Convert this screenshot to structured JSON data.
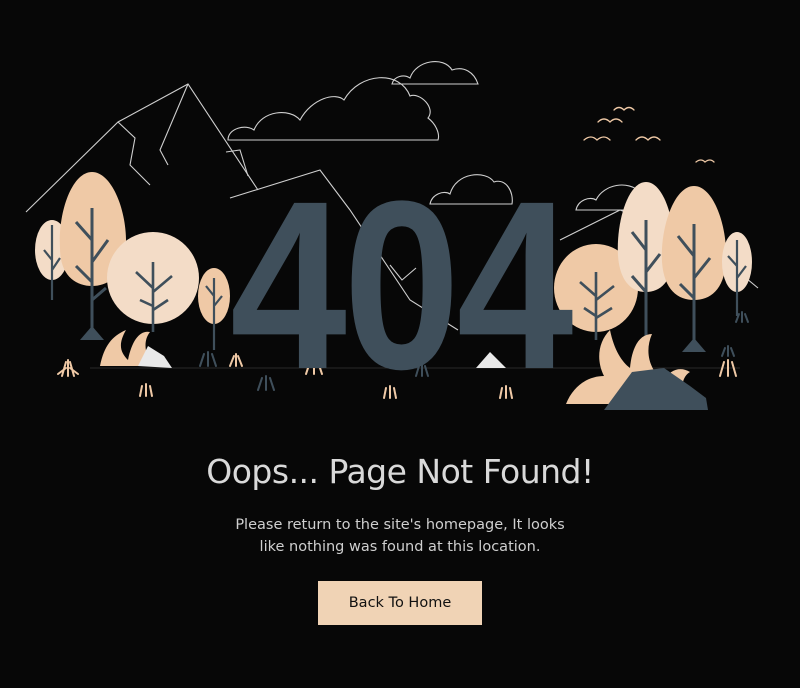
{
  "illustration": {
    "error_code": "404",
    "colors": {
      "background": "#070707",
      "digits": "#3f4f5b",
      "foliage_light": "#f3dcc7",
      "foliage_mid": "#efc9a6",
      "trunk": "#3f4f5b",
      "outline": "#cfcfcf"
    }
  },
  "content": {
    "headline": "Oops... Page Not Found!",
    "message": "Please return to the site's homepage, It looks like nothing was found at this location."
  },
  "actions": {
    "back_label": "Back To Home"
  }
}
